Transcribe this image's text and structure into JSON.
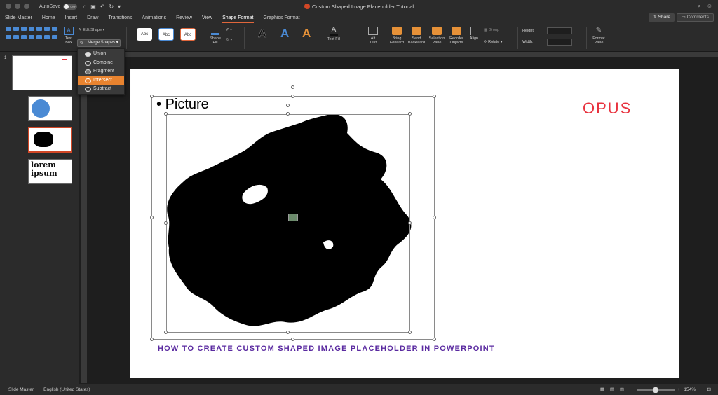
{
  "titlebar": {
    "autosave_label": "AutoSave",
    "autosave_state": "OFF",
    "doc_title": "Custom Shaped Image Placeholder Tutorial"
  },
  "tabs": [
    "Slide Master",
    "Home",
    "Insert",
    "Draw",
    "Transitions",
    "Animations",
    "Review",
    "View",
    "Shape Format",
    "Graphics Format"
  ],
  "active_tab": "Shape Format",
  "header_buttons": {
    "share": "Share",
    "comments": "Comments"
  },
  "ribbon": {
    "text_box": "Text\nBox",
    "edit_shape": "Edit Shape",
    "merge_shapes": "Merge Shapes",
    "style_samples": [
      "Abc",
      "Abc",
      "Abc"
    ],
    "shape_fill": "Shape\nFill",
    "wordart": [
      "A",
      "A",
      "A"
    ],
    "text_fill": "Text Fill",
    "alt_text": "Alt\nText",
    "bring_forward": "Bring\nForward",
    "send_backward": "Send\nBackward",
    "selection_pane": "Selection\nPane",
    "reorder_objects": "Reorder\nObjects",
    "align": "Align",
    "group": "Group",
    "rotate": "Rotate",
    "height_label": "Height:",
    "width_label": "Width:",
    "format_pane": "Format\nPane"
  },
  "merge_menu": [
    "Union",
    "Combine",
    "Fragment",
    "Intersect",
    "Subtract"
  ],
  "merge_menu_highlighted": "Intersect",
  "thumbnails": [
    {
      "num": "1"
    },
    {
      "num": ""
    },
    {
      "num": ""
    },
    {
      "num": "",
      "text": "lorem ipsum"
    }
  ],
  "slide": {
    "bullet_text": "Picture",
    "logo": "OPUS",
    "footer_title": "HOW TO CREATE CUSTOM SHAPED IMAGE PLACEHOLDER IN POWERPOINT"
  },
  "statusbar": {
    "view": "Slide Master",
    "language": "English (United States)",
    "zoom": "154%"
  },
  "colors": {
    "accent": "#e0663b",
    "highlight": "#e8832f",
    "logo": "#e8323e",
    "footer_title": "#5a2aa0"
  }
}
